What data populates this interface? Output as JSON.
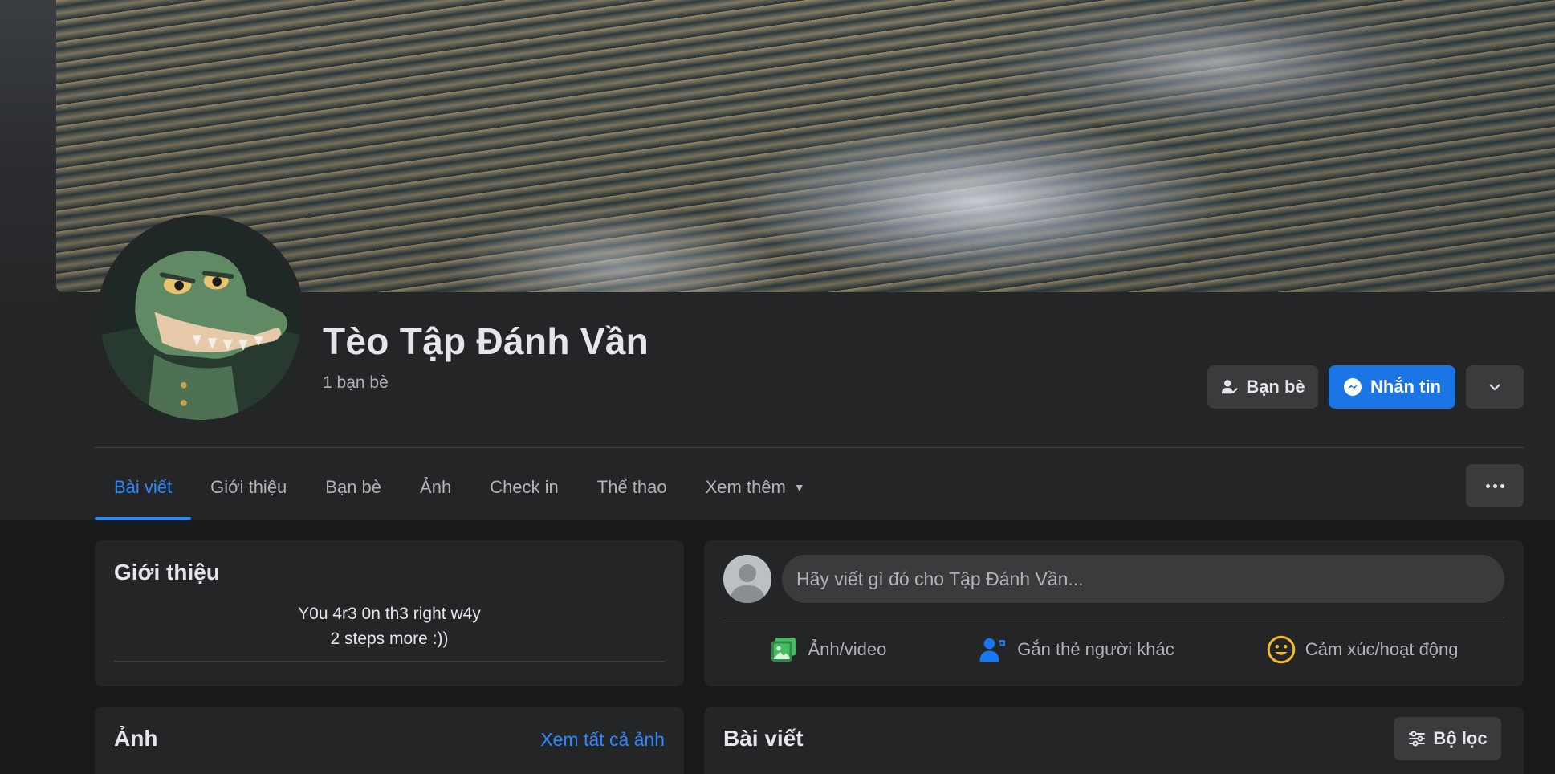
{
  "profile": {
    "name": "Tèo Tập Đánh Vần",
    "friend_count": "1 bạn bè"
  },
  "actions": {
    "friends_label": "Bạn bè",
    "message_label": "Nhắn tin"
  },
  "tabs": [
    {
      "label": "Bài viết",
      "active": true
    },
    {
      "label": "Giới thiệu"
    },
    {
      "label": "Bạn bè"
    },
    {
      "label": "Ảnh"
    },
    {
      "label": "Check in"
    },
    {
      "label": "Thể thao"
    },
    {
      "label": "Xem thêm"
    }
  ],
  "intro": {
    "title": "Giới thiệu",
    "bio_line1": "Y0u 4r3 0n th3 right w4y",
    "bio_line2": "2 steps more :))"
  },
  "photos": {
    "title": "Ảnh",
    "see_all": "Xem tất cả ảnh"
  },
  "composer": {
    "placeholder": "Hãy viết gì đó cho Tập Đánh Vần...",
    "photo_video": "Ảnh/video",
    "tag_people": "Gắn thẻ người khác",
    "feeling": "Cảm xúc/hoạt động"
  },
  "posts": {
    "title": "Bài viết",
    "filter_label": "Bộ lọc"
  },
  "colors": {
    "background": "#18191a",
    "surface": "#242526",
    "button": "#3a3b3c",
    "accent": "#1b74e4",
    "link": "#2d88ff",
    "text_primary": "#e4e6eb",
    "text_secondary": "#b0b3b8"
  },
  "icons": {
    "friends": "person-check-icon",
    "message": "messenger-icon",
    "more": "chevron-down-icon",
    "tab_more": "caret-down-icon",
    "dots": "more-dots-icon",
    "photo": "photo-video-icon",
    "tag": "tag-people-icon",
    "feeling": "smiley-icon",
    "filter": "filter-sliders-icon"
  }
}
